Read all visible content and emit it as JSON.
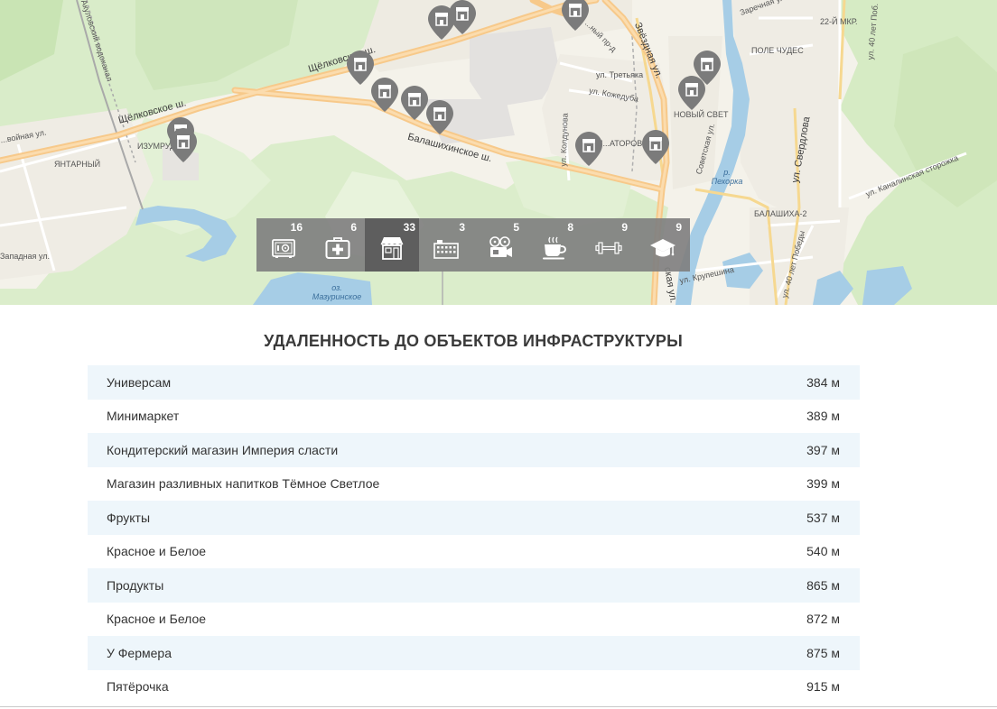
{
  "map": {
    "labels": {
      "shchelkovskoe_1": "Щёлковское ш.",
      "shchelkovskoe_2": "Щёлковское ш.",
      "balashikhinskoe": "Балашихинское ш.",
      "zvezdnaya": "Звёздная ул.",
      "akulovsky": "Акуловский водоканал",
      "izumrud": "ИЗУМРУД",
      "yantarny": "ЯНТАРНЫЙ",
      "zapadnaya": "Западная ул.",
      "tretyaka": "ул. Третьяка",
      "kozhedubа": "ул. Кожедуба",
      "koldunova": "ул. Колдунова",
      "noviy_svet": "НОВЫЙ СВЕТ",
      "pole_chudes": "ПОЛЕ ЧУДЕС",
      "mkr22": "22-Й МКР.",
      "river": "р.\nПехорка",
      "sverdlova": "ул. Свердлова",
      "balashikha2": "БАЛАШИХА-2",
      "pobedy": "ул. 40 лет Победы",
      "krupeshina": "ул. Крупешина",
      "kanalinskaya": "ул. Каналинская сторожка",
      "lake": "оз.\nМазуринское",
      "sovetskaya": "Советская ул.",
      "zarechnaya": "Заречная ул.",
      "pobedy_top": "ул. 40 лет Поб.",
      "spasskaya": "ская ул.",
      "atorov": "М...АТОРОВ",
      "voynaya": "...войная ул.",
      "proezd": "...ный пр-д"
    }
  },
  "categories": [
    {
      "id": "banks",
      "icon": "safe-icon",
      "count": "16",
      "active": false
    },
    {
      "id": "medicine",
      "icon": "first-aid-kit-icon",
      "count": "6",
      "active": false
    },
    {
      "id": "shops",
      "icon": "shop-icon",
      "count": "33",
      "active": true
    },
    {
      "id": "business",
      "icon": "building-icon",
      "count": "3",
      "active": false
    },
    {
      "id": "cinema",
      "icon": "film-camera-icon",
      "count": "5",
      "active": false
    },
    {
      "id": "cafe",
      "icon": "coffee-cup-icon",
      "count": "8",
      "active": false
    },
    {
      "id": "sport",
      "icon": "dumbbell-icon",
      "count": "9",
      "active": false
    },
    {
      "id": "education",
      "icon": "graduation-cap-icon",
      "count": "9",
      "active": false
    }
  ],
  "section": {
    "title": "УДАЛЕННОСТЬ ДО ОБЪЕКТОВ ИНФРАСТРУКТУРЫ"
  },
  "distances": [
    {
      "name": "Универсам",
      "distance": "384 м"
    },
    {
      "name": "Минимаркет",
      "distance": "389 м"
    },
    {
      "name": "Кондитерский магазин Империя сласти",
      "distance": "397 м"
    },
    {
      "name": "Магазин разливных напитков Тёмное Светлое",
      "distance": "399 м"
    },
    {
      "name": "Фрукты",
      "distance": "537 м"
    },
    {
      "name": "Красное и Белое",
      "distance": "540 м"
    },
    {
      "name": "Продукты",
      "distance": "865 м"
    },
    {
      "name": "Красное и Белое",
      "distance": "872 м"
    },
    {
      "name": "У Фермера",
      "distance": "875 м"
    },
    {
      "name": "Пятёрочка",
      "distance": "915 м"
    }
  ]
}
